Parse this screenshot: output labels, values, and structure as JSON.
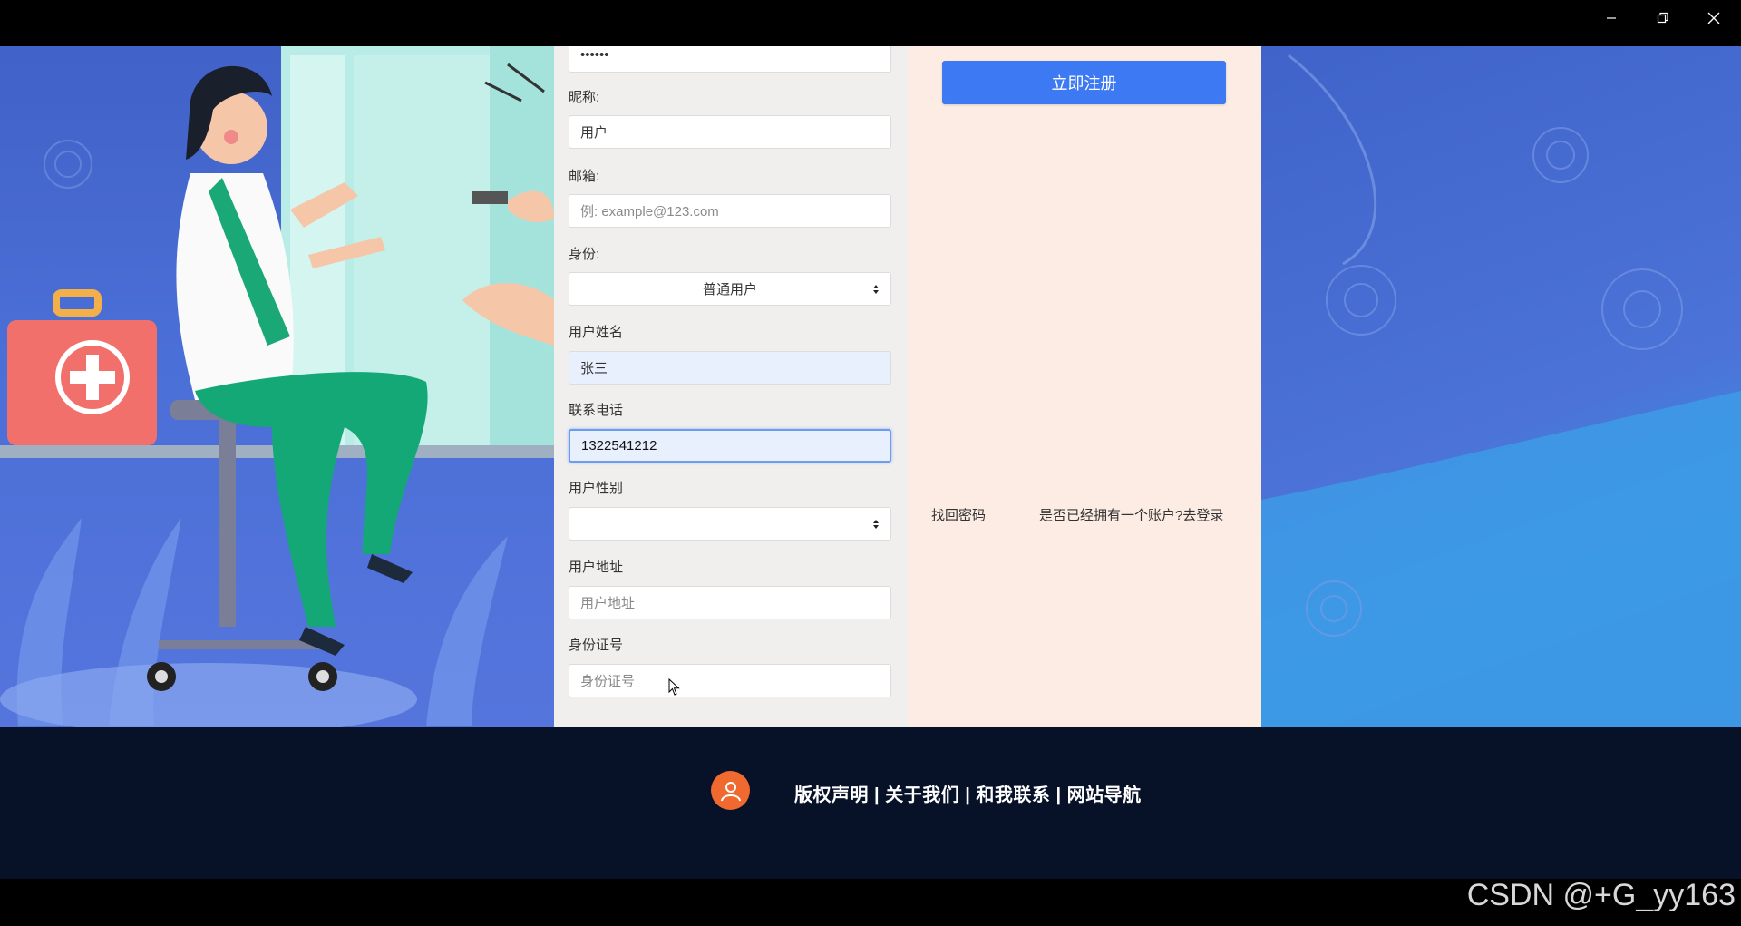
{
  "window": {
    "controls": [
      "minimize-icon",
      "restore-icon",
      "close-icon"
    ]
  },
  "form": {
    "password_value": "••••••",
    "nickname_label": "昵称:",
    "nickname_value": "用户",
    "email_label": "邮箱:",
    "email_placeholder": "例: example@123.com",
    "role_label": "身份:",
    "role_value": "普通用户",
    "name_label": "用户姓名",
    "name_value": "张三",
    "phone_label": "联系电话",
    "phone_value": "1322541212",
    "gender_label": "用户性别",
    "gender_value": "",
    "address_label": "用户地址",
    "address_placeholder": "用户地址",
    "idcard_label": "身份证号",
    "idcard_placeholder": "身份证号"
  },
  "side": {
    "register_button": "立即注册",
    "find_password": "找回密码",
    "login_link": "是否已经拥有一个账户?去登录"
  },
  "footer": {
    "links_text": "版权声明 | 关于我们 | 和我联系 | 网站导航",
    "avatar_icon": "user-icon"
  },
  "watermark": "CSDN @+G_yy163",
  "colors": {
    "accent": "#3d79f2",
    "footer_bg": "#071127",
    "form_bg": "#f1eeee",
    "side_bg": "#fdece4",
    "avatar": "#f06a30"
  }
}
